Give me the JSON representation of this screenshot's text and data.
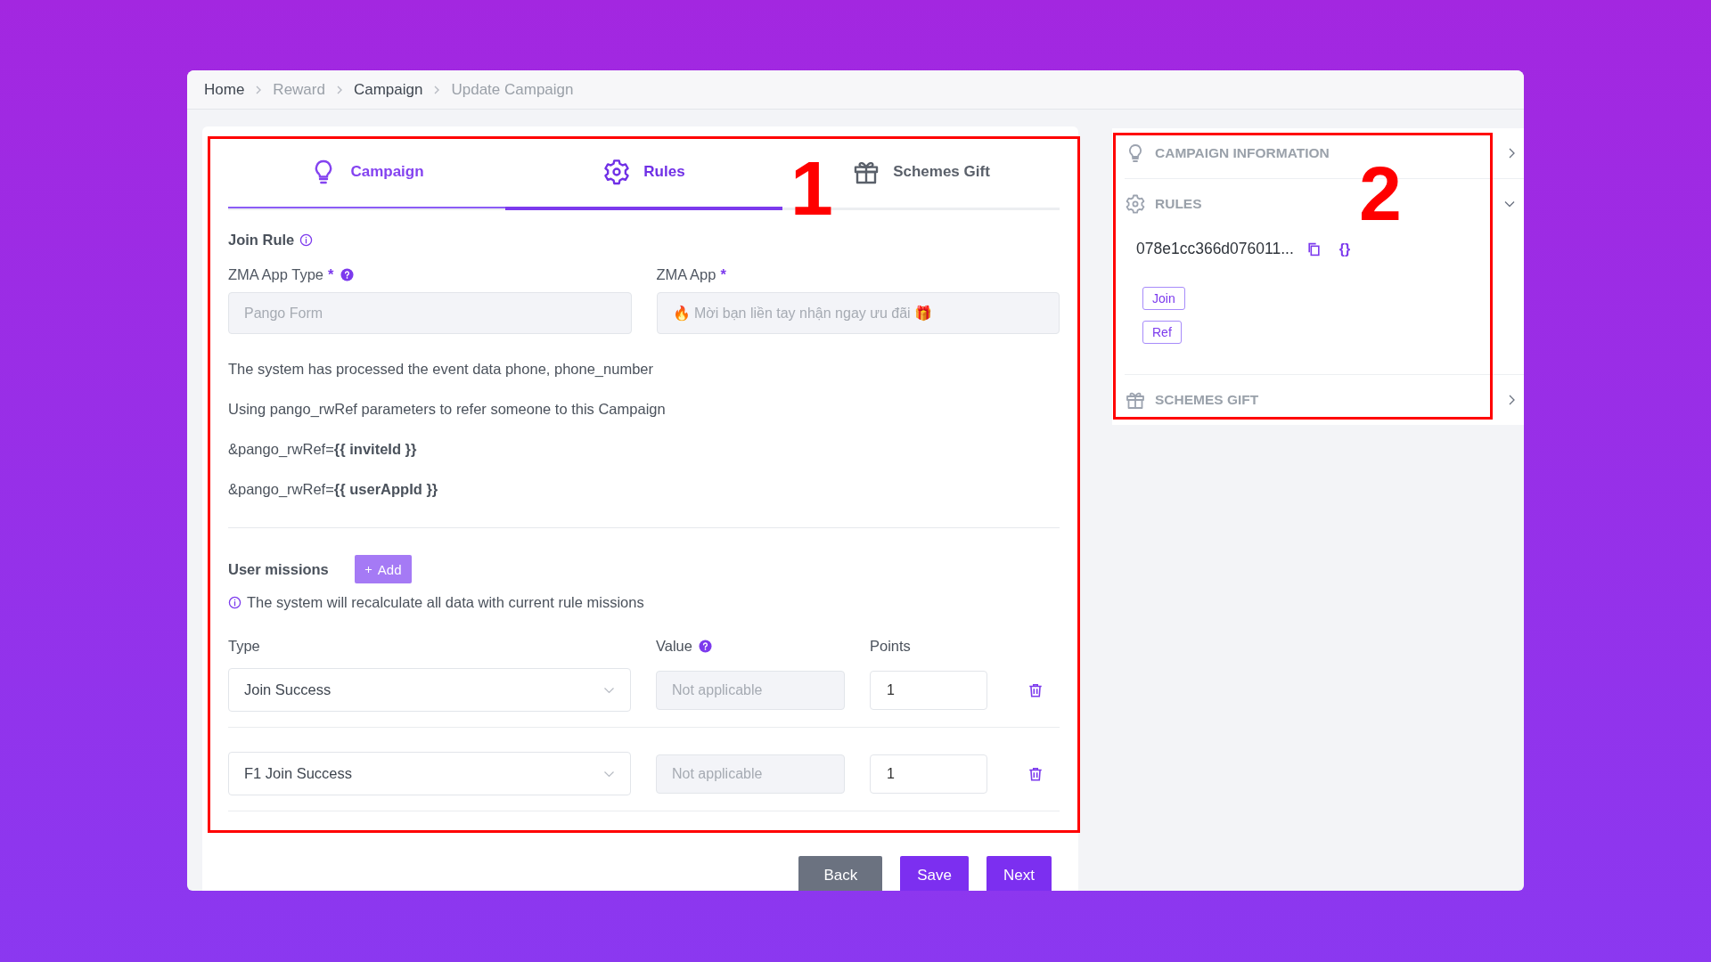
{
  "breadcrumb": [
    {
      "label": "Home",
      "muted": false
    },
    {
      "label": "Reward",
      "muted": true
    },
    {
      "label": "Campaign",
      "muted": false
    },
    {
      "label": "Update Campaign",
      "muted": true
    }
  ],
  "tabs": [
    {
      "label": "Campaign",
      "kind": "bulb",
      "selected": false,
      "completed": true
    },
    {
      "label": "Rules",
      "kind": "gear",
      "selected": true,
      "completed": false
    },
    {
      "label": "Schemes Gift",
      "kind": "gift",
      "selected": false,
      "completed": false
    }
  ],
  "join_rule": {
    "title": "Join Rule",
    "fields": [
      {
        "label": "ZMA App Type",
        "required_mark": "*",
        "help": true,
        "value": "Pango Form",
        "disabled": true
      },
      {
        "label": "ZMA App",
        "required_mark": "*",
        "help": false,
        "value": "🔥 Mời bạn liền tay nhận ngay ưu đãi 🎁",
        "disabled": true
      }
    ],
    "notes": [
      "The system has processed the event data phone, phone_number",
      "Using pango_rwRef parameters to refer someone to this Campaign",
      "&pango_rwRef=**{{ inviteId }}**",
      "&pango_rwRef=**{{ userAppId }}**"
    ]
  },
  "user_missions": {
    "title": "User missions",
    "add_button": "Add",
    "info": "The system will recalculate all data with current rule missions",
    "columns": [
      {
        "label": "Type",
        "help": false
      },
      {
        "label": "Value",
        "help": true
      },
      {
        "label": "Points",
        "help": false
      }
    ],
    "rows": [
      {
        "type": "Join Success",
        "value_placeholder": "Not applicable",
        "points": "1"
      },
      {
        "type": "F1 Join Success",
        "value_placeholder": "Not applicable",
        "points": "1"
      }
    ]
  },
  "actions": [
    {
      "label": "Back",
      "kind": "secondary"
    },
    {
      "label": "Save",
      "kind": "primary"
    },
    {
      "label": "Next",
      "kind": "primary"
    }
  ],
  "sidebar": {
    "sections": [
      {
        "title": "CAMPAIGN INFORMATION",
        "kind": "bulb",
        "expanded": false
      },
      {
        "title": "RULES",
        "kind": "gear",
        "expanded": true,
        "rule_id": "078e1cc366d076011...",
        "json_icon": "{}",
        "tags": [
          "Join",
          "Ref"
        ]
      },
      {
        "title": "SCHEMES GIFT",
        "kind": "gift",
        "expanded": false
      }
    ]
  },
  "annotations": [
    {
      "label": "1"
    },
    {
      "label": "2"
    }
  ]
}
